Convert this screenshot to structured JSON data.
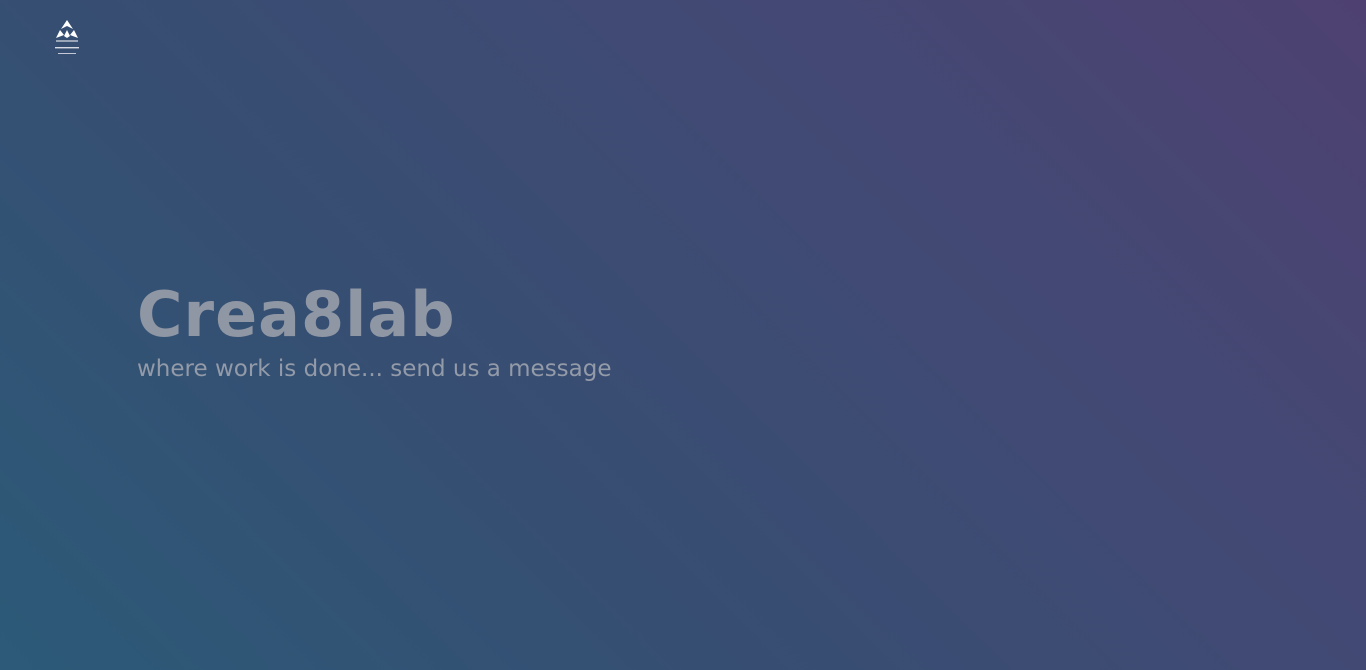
{
  "header": {
    "logo_icon": "crea8lab-logo-icon"
  },
  "hero": {
    "title": "Crea8lab",
    "subtitle": "where work is done... send us a message"
  },
  "colors": {
    "background_start": "#2c5a78",
    "background_end": "#4e4172",
    "title_text": "#8f96a4",
    "subtitle_text": "#939aa8"
  }
}
